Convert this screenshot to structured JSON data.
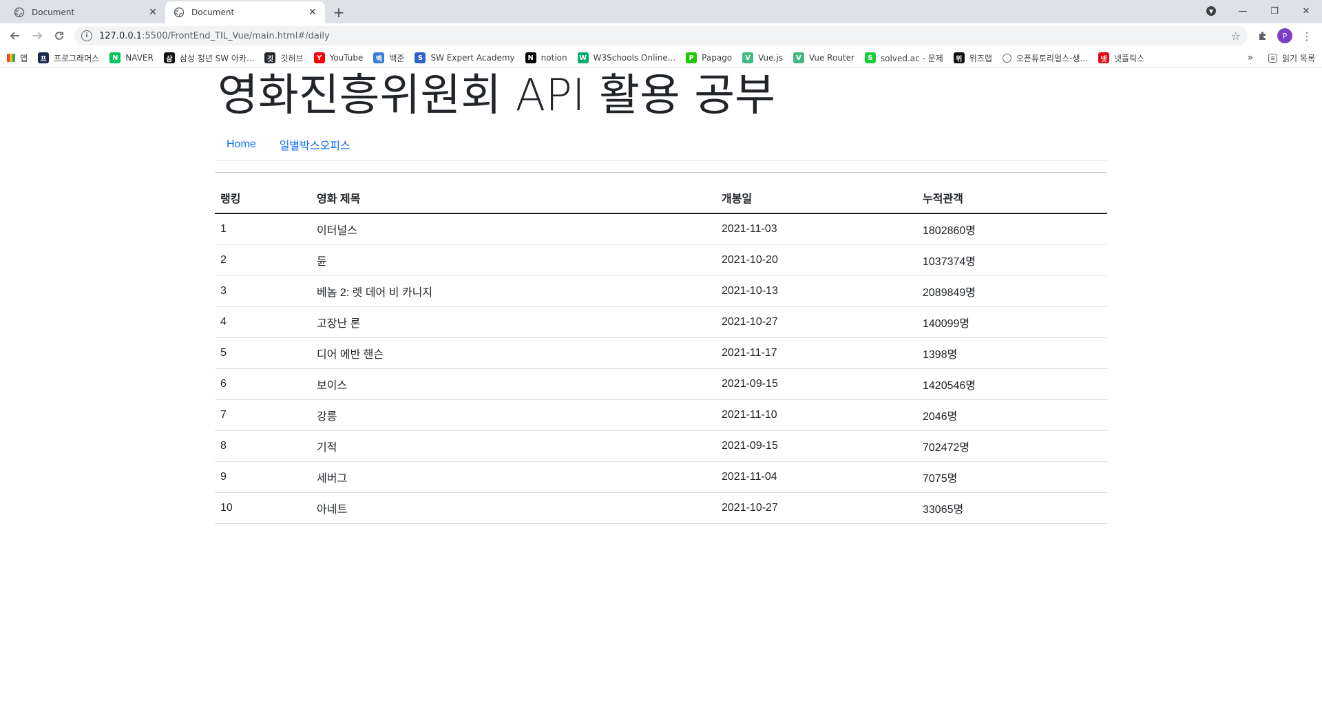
{
  "browser": {
    "tabs": [
      {
        "title": "Document"
      },
      {
        "title": "Document"
      }
    ],
    "url": {
      "host": "127.0.0.1",
      "path": ":5500/FrontEnd_TIL_Vue/main.html#/daily"
    },
    "profile_initial": "P",
    "bookmarks": [
      {
        "label": "앱",
        "icon": "apps-icon",
        "color": "#ea4335"
      },
      {
        "label": "프로그래머스",
        "icon": "programmers-icon",
        "color": "#1a2b4d"
      },
      {
        "label": "NAVER",
        "icon": "naver-icon",
        "color": "#03c75a"
      },
      {
        "label": "삼성 청년 SW 아카...",
        "icon": "ssafy-icon",
        "color": "#111111"
      },
      {
        "label": "깃허브",
        "icon": "github-icon",
        "color": "#24292e"
      },
      {
        "label": "YouTube",
        "icon": "youtube-icon",
        "color": "#ff0000"
      },
      {
        "label": "백준",
        "icon": "baekjoon-icon",
        "color": "#3b7dd8"
      },
      {
        "label": "SW Expert Academy",
        "icon": "swea-icon",
        "color": "#2e63c9"
      },
      {
        "label": "notion",
        "icon": "notion-icon",
        "color": "#000000"
      },
      {
        "label": "W3Schools Online...",
        "icon": "w3schools-icon",
        "color": "#04aa6d"
      },
      {
        "label": "Papago",
        "icon": "papago-icon",
        "color": "#1ec800"
      },
      {
        "label": "Vue.js",
        "icon": "vue-icon",
        "color": "#42b883"
      },
      {
        "label": "Vue Router",
        "icon": "vue-router-icon",
        "color": "#42b883"
      },
      {
        "label": "solved.ac - 문제",
        "icon": "solvedac-icon",
        "color": "#17ce3a"
      },
      {
        "label": "위즈랩",
        "icon": "wizlab-icon",
        "color": "#111111"
      },
      {
        "label": "오픈튜토리얼스-생...",
        "icon": "globe-icon",
        "color": "#5f6368"
      },
      {
        "label": "넷플릭스",
        "icon": "netflix-icon",
        "color": "#e50914"
      }
    ],
    "reading_list": "읽기 목록"
  },
  "page": {
    "title": "영화진흥위원회 API 활용 공부",
    "nav": [
      {
        "label": "Home"
      },
      {
        "label": "일별박스오피스"
      }
    ],
    "table": {
      "headers": [
        "랭킹",
        "영화 제목",
        "개봉일",
        "누적관객"
      ],
      "rows": [
        [
          "1",
          "이터널스",
          "2021-11-03",
          "1802860명"
        ],
        [
          "2",
          "듄",
          "2021-10-20",
          "1037374명"
        ],
        [
          "3",
          "베놈 2: 렛 데어 비 카니지",
          "2021-10-13",
          "2089849명"
        ],
        [
          "4",
          "고장난 론",
          "2021-10-27",
          "140099명"
        ],
        [
          "5",
          "디어 에반 핸슨",
          "2021-11-17",
          "1398명"
        ],
        [
          "6",
          "보이스",
          "2021-09-15",
          "1420546명"
        ],
        [
          "7",
          "강릉",
          "2021-11-10",
          "2046명"
        ],
        [
          "8",
          "기적",
          "2021-09-15",
          "702472명"
        ],
        [
          "9",
          "세버그",
          "2021-11-04",
          "7075명"
        ],
        [
          "10",
          "아네트",
          "2021-10-27",
          "33065명"
        ]
      ]
    }
  },
  "colors": {
    "link": "#0d6efd",
    "tabbar": "#dee1e6"
  }
}
